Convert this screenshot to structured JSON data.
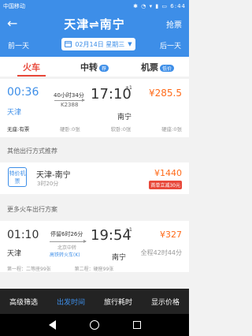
{
  "status": {
    "carrier": "中国移动",
    "time": "6:44",
    "icons": "✱ ◔ ▾ ▮",
    "battery": "▭"
  },
  "header": {
    "title": "天津⇌南宁",
    "grab_label": "抢票",
    "prev_day": "前一天",
    "next_day": "后一天",
    "date": "02月14日 星期三"
  },
  "tabs": [
    {
      "label": "火车",
      "badge": ""
    },
    {
      "label": "中转",
      "badge": "荐"
    },
    {
      "label": "机票",
      "badge": "低价"
    }
  ],
  "train": {
    "dep_time": "00:36",
    "dep_station": "天津",
    "duration": "40小时34分",
    "train_no": "K2388",
    "arr_time": "17:10",
    "day_offset": "+1",
    "arr_station": "南宁",
    "price": "¥285.5",
    "seats": [
      "无座:有票",
      "硬卧:0张",
      "软卧:0张",
      "硬座:0张"
    ]
  },
  "other": {
    "section_title": "其他出行方式推荐",
    "icon_label": "特价机票",
    "route": "天津-南宁",
    "duration": "3时20分",
    "price": "¥1440",
    "discount": "首单立减30元"
  },
  "more": {
    "section_title": "更多火车出行方案",
    "dep_time": "01:10",
    "dep_station": "天津",
    "stop_info": "停留6时26分",
    "via": "北京中转",
    "line_name": "高铁转火车(K)",
    "arr_time": "19:54",
    "day_offset": "+1",
    "arr_station": "南宁",
    "price": "¥327",
    "total": "全程42时44分",
    "seats": [
      "第一程：二等座99张",
      "第二程：硬座99张"
    ]
  },
  "filters": [
    "高级筛选",
    "出发时间",
    "旅行耗时",
    "显示价格"
  ],
  "colors": {
    "primary": "#3d8ee8",
    "accent": "#e8483a",
    "price": "#ff6b1a"
  }
}
